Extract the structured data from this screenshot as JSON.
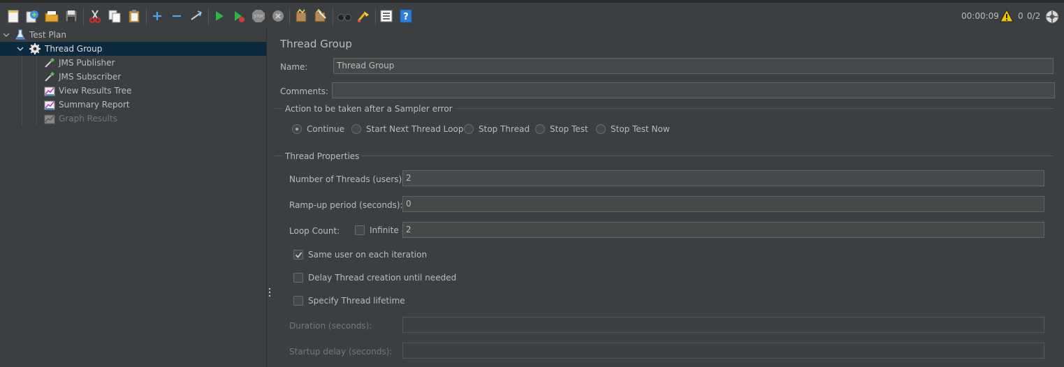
{
  "toolbar": {
    "icons": [
      "new-icon",
      "templates-icon",
      "open-icon",
      "save-icon",
      "cut-icon",
      "copy-icon",
      "paste-icon",
      "expand-icon",
      "collapse-icon",
      "toggle-icon",
      "start-icon",
      "start-no-pause-icon",
      "stop-icon",
      "shutdown-icon",
      "clear-icon",
      "clear-all-icon",
      "search-icon",
      "reset-search-icon",
      "function-helper-icon",
      "help-icon"
    ],
    "elapsed": "00:00:09",
    "warnings": "0",
    "threads": "0/2"
  },
  "tree": {
    "items": [
      {
        "label": "Test Plan",
        "icon": "flask-icon"
      },
      {
        "label": "Thread Group",
        "icon": "gear-icon"
      },
      {
        "label": "JMS Publisher",
        "icon": "pipette-icon"
      },
      {
        "label": "JMS Subscriber",
        "icon": "pipette-icon"
      },
      {
        "label": "View Results Tree",
        "icon": "graph-icon"
      },
      {
        "label": "Summary Report",
        "icon": "graph-icon"
      },
      {
        "label": "Graph Results",
        "icon": "graph-icon"
      }
    ]
  },
  "panel": {
    "title": "Thread Group",
    "name_label": "Name:",
    "name_value": "Thread Group",
    "comments_label": "Comments:",
    "comments_value": "",
    "error_group": {
      "title": "Action to be taken after a Sampler error",
      "options": [
        "Continue",
        "Start Next Thread Loop",
        "Stop Thread",
        "Stop Test",
        "Stop Test Now"
      ],
      "selected": "Continue"
    },
    "props": {
      "title": "Thread Properties",
      "threads_label": "Number of Threads (users):",
      "threads_value": "2",
      "rampup_label": "Ramp-up period (seconds):",
      "rampup_value": "0",
      "loop_label": "Loop Count:",
      "infinite_label": "Infinite",
      "infinite_checked": false,
      "loop_value": "2",
      "same_user_label": "Same user on each iteration",
      "same_user_checked": true,
      "delay_label": "Delay Thread creation until needed",
      "delay_checked": false,
      "lifetime_label": "Specify Thread lifetime",
      "lifetime_checked": false,
      "duration_label": "Duration (seconds):",
      "duration_value": "",
      "startup_label": "Startup delay (seconds):",
      "startup_value": ""
    }
  },
  "colors": {
    "background": "#3c3f41",
    "selection": "#0d293e",
    "field": "#45494a",
    "text": "#bbbbbb"
  }
}
